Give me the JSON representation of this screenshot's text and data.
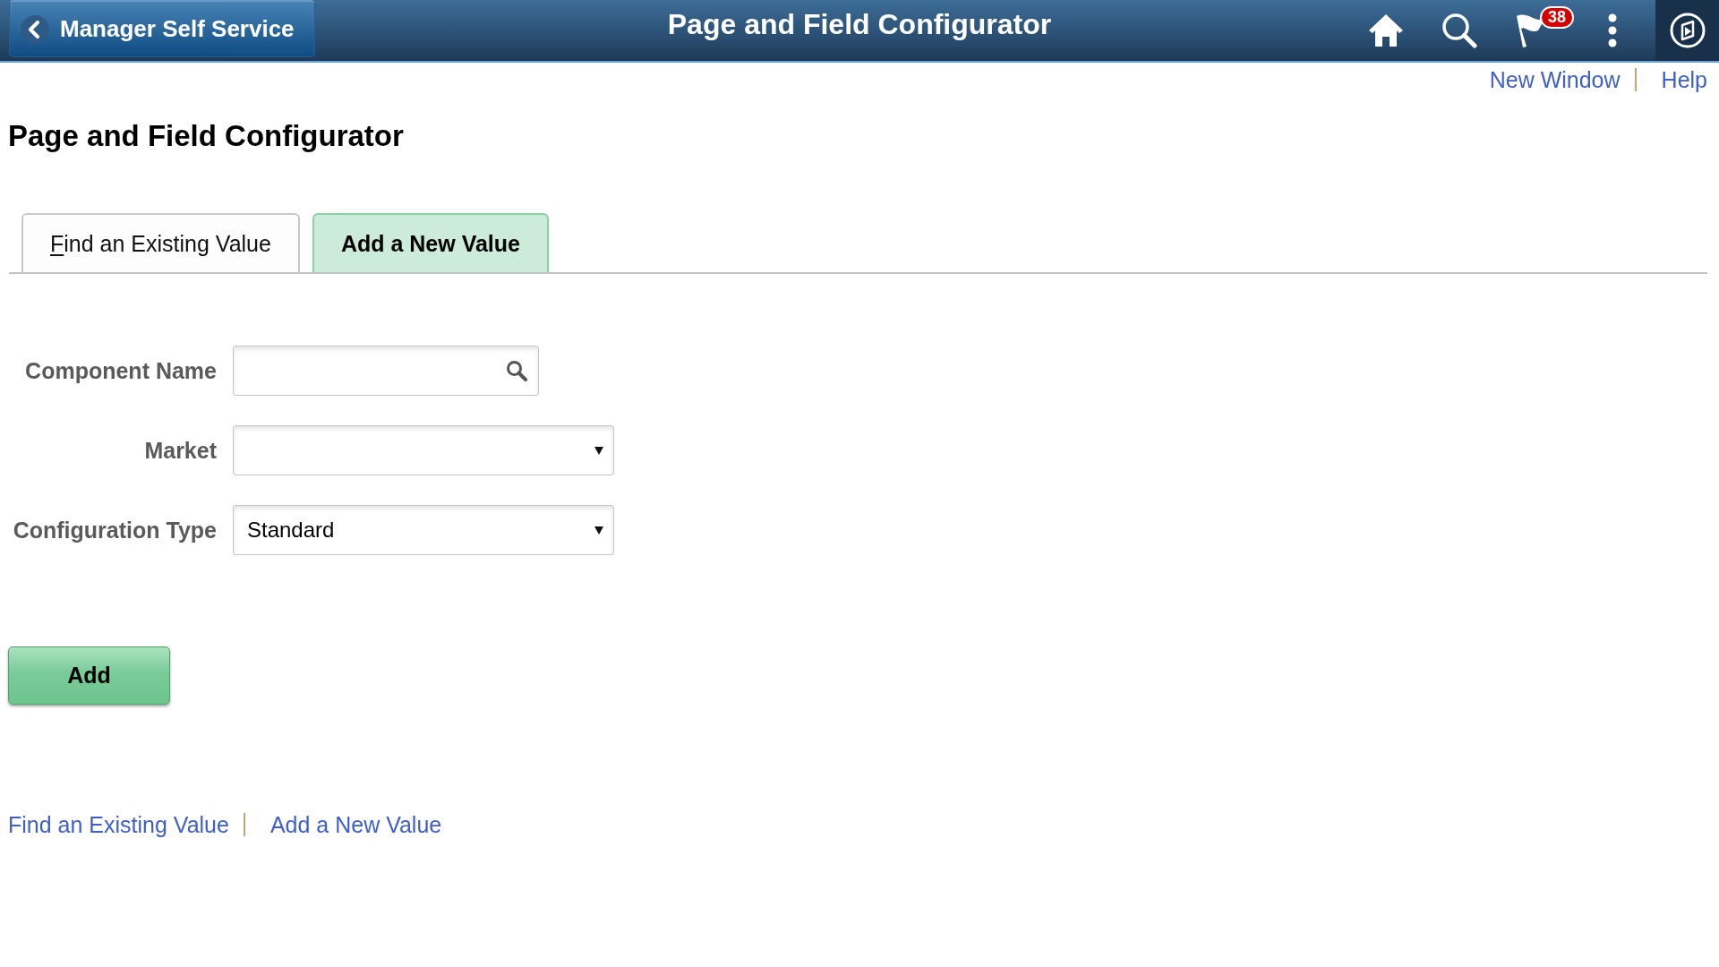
{
  "header": {
    "back_button": "Manager Self Service",
    "title": "Page and Field Configurator",
    "notification_badge": "38"
  },
  "page_links": [
    {
      "label": "New Window"
    },
    {
      "label": "Help"
    }
  ],
  "page_title": "Page and Field Configurator",
  "tabs": [
    {
      "label": "Find an Existing Value",
      "selected": false,
      "access_key_underlined": true
    },
    {
      "label": "Add a New Value",
      "selected": true,
      "access_key_underlined": false
    }
  ],
  "form": {
    "fields": [
      {
        "label": "Component Name",
        "kind": "lookup"
      },
      {
        "label": "Market",
        "kind": "dropdown"
      },
      {
        "label": "Configuration Type",
        "kind": "dropdown",
        "value": "Standard"
      }
    ]
  },
  "add_button": "Add",
  "footer_links": [
    {
      "label": "Find an Existing Value"
    },
    {
      "label": "Add a New Value"
    }
  ]
}
